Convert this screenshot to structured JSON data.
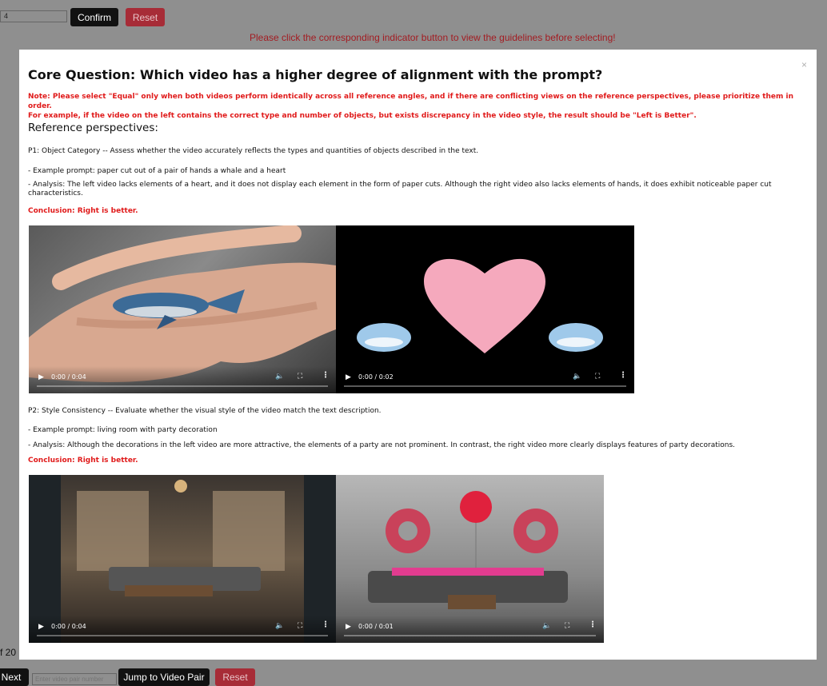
{
  "background": {
    "pair_input_value": "4",
    "confirm_label": "Confirm",
    "reset_label": "Reset",
    "warning": "Please click the corresponding indicator button to view the guidelines before selecting!",
    "page_info": "f 20",
    "next_label": "Next",
    "jump_placeholder": "Enter video pair number",
    "jump_label": "Jump to Video Pair",
    "reset_bottom_label": "Reset"
  },
  "modal": {
    "close_glyph": "×",
    "title": "Core Question: Which video has a higher degree of alignment with the prompt?",
    "note_line1": "Note: Please select \"Equal\" only when both videos perform identically across all reference angles, and if there are conflicting views on the reference perspectives, please prioritize them in order.",
    "note_line2": "For example, if the video on the left contains the correct type and number of objects, but exists discrepancy in the video style, the result should be \"Left is Better\".",
    "reference_title": "Reference perspectives:",
    "p1": {
      "heading": "P1: Object Category -- Assess whether the video accurately reflects the types and quantities of objects described in the text.",
      "prompt": "- Example prompt: paper cut out of a pair of hands a whale and a heart",
      "analysis": "- Analysis: The left video lacks elements of a heart, and it does not display each element in the form of paper cuts. Although the right video also lacks elements of hands, it does exhibit noticeable paper cut characteristics.",
      "conclusion": "Conclusion: Right is better.",
      "left_time": "0:00 / 0:04",
      "right_time": "0:00 / 0:02"
    },
    "p2": {
      "heading": "P2: Style Consistency -- Evaluate whether the visual style of the video match the text description.",
      "prompt": "- Example prompt: living room with party decoration",
      "analysis": "- Analysis: Although the decorations in the left video are more attractive, the elements of a party are not prominent. In contrast, the right video more clearly displays features of party decorations.",
      "conclusion": "Conclusion: Right is better.",
      "left_time": "0:00 / 0:04",
      "right_time": "0:00 / 0:01"
    }
  },
  "player_icons": {
    "play": "▶",
    "volume": "🔈",
    "fullscreen": "⛶",
    "more": "⋮"
  }
}
